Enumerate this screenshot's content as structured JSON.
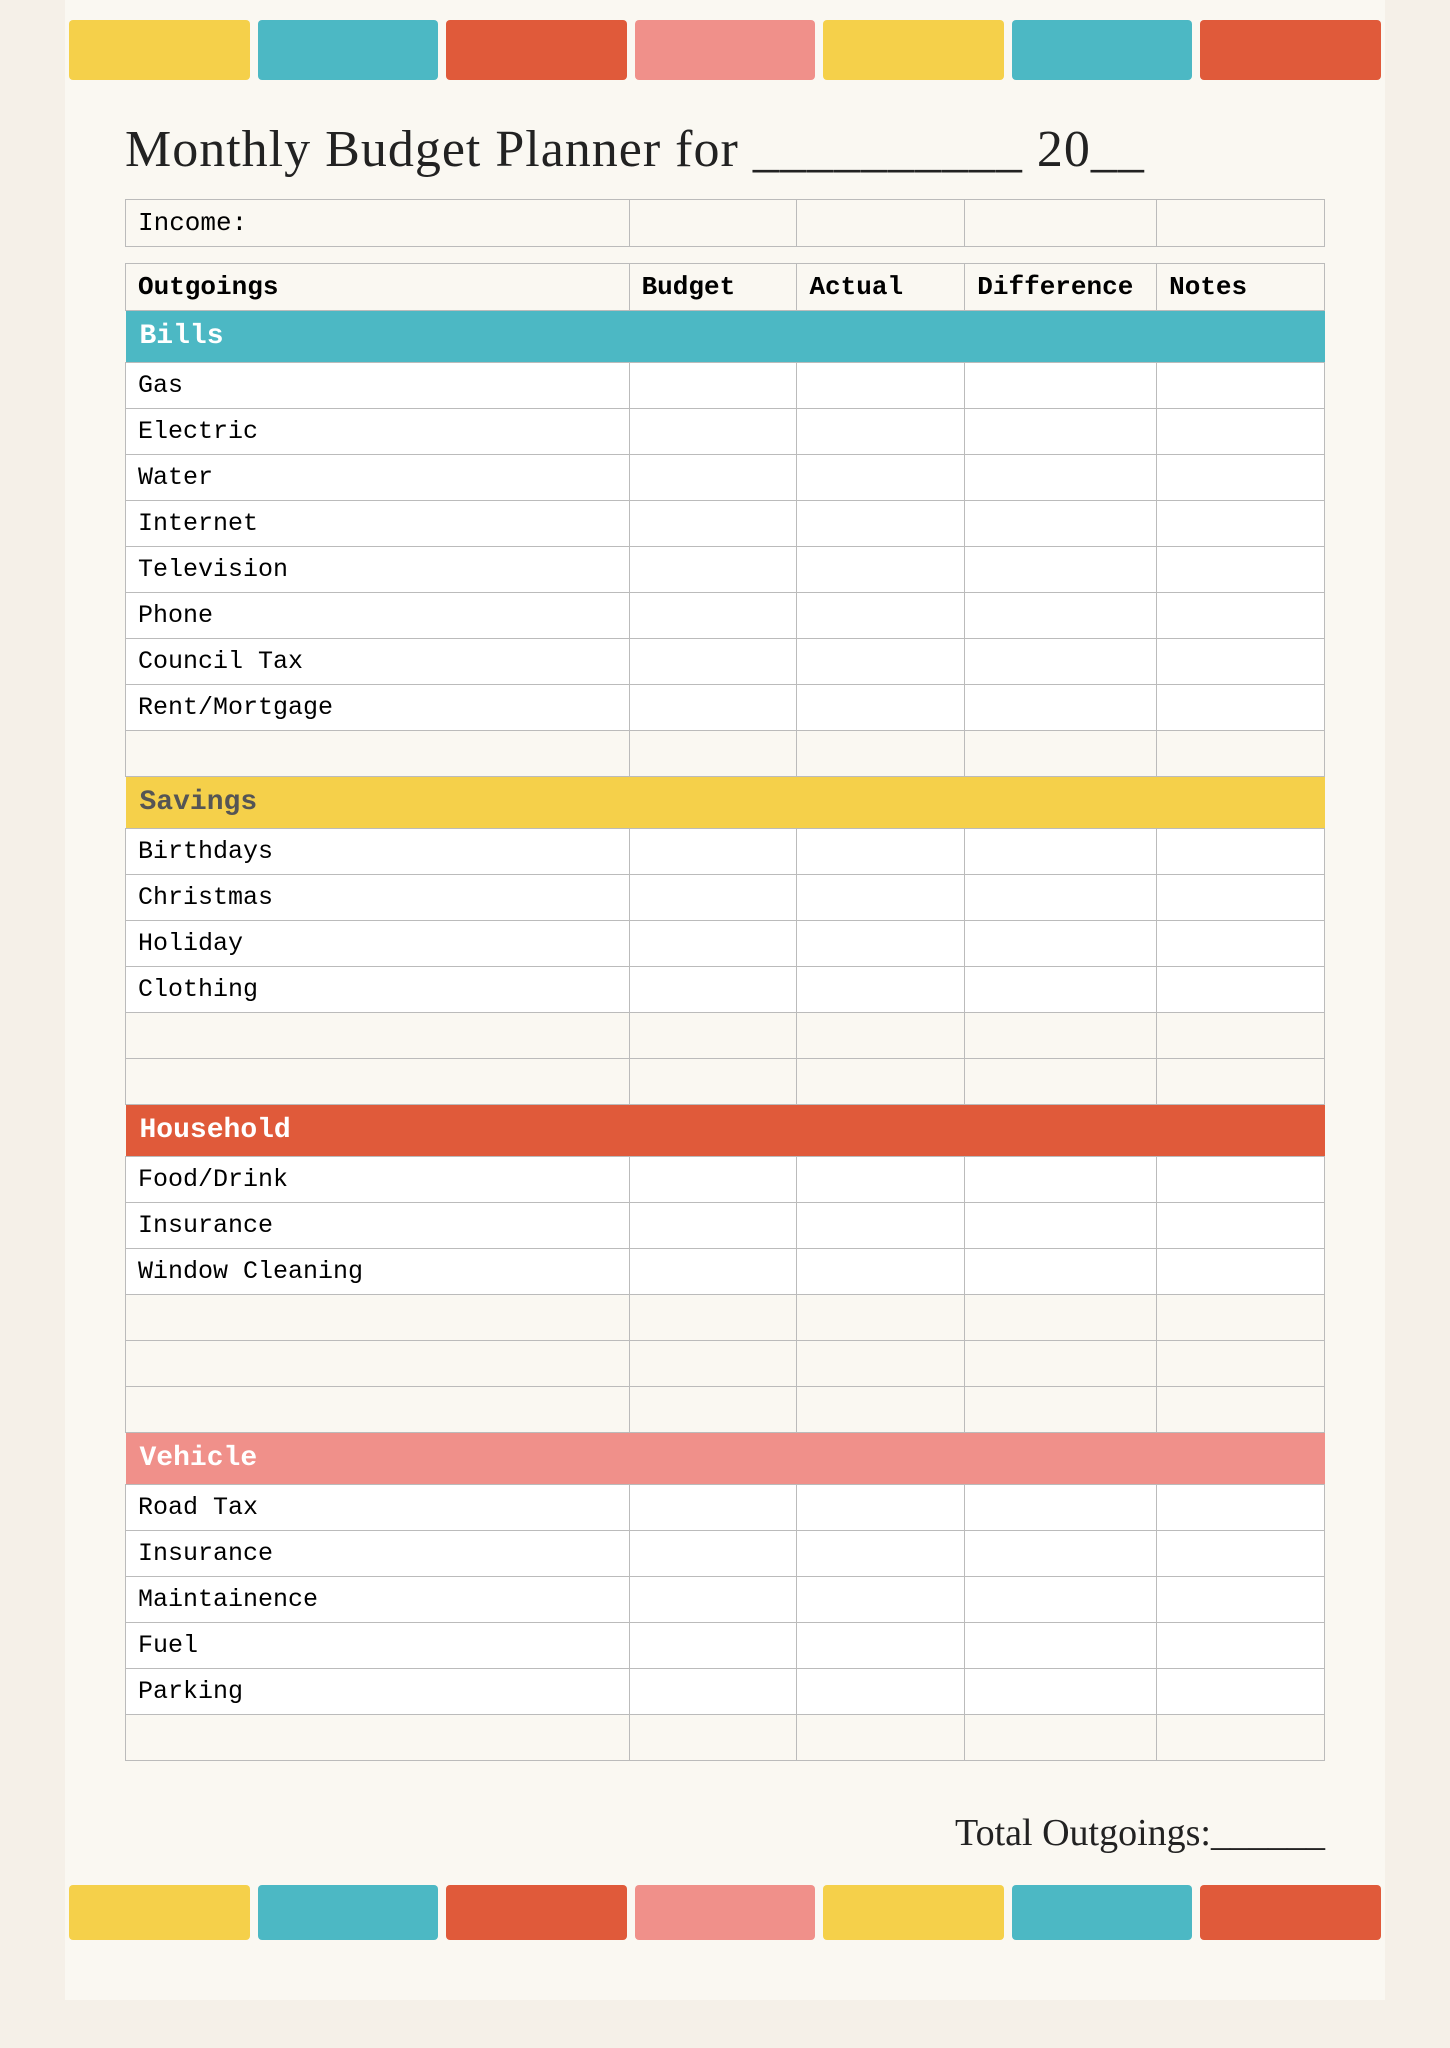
{
  "page": {
    "title": "Monthly Budget Planner for __________ 20__",
    "color_bars": [
      {
        "color": "yellow",
        "class": "cb-yellow"
      },
      {
        "color": "teal",
        "class": "cb-teal"
      },
      {
        "color": "red",
        "class": "cb-red"
      },
      {
        "color": "pink",
        "class": "cb-pink"
      },
      {
        "color": "yellow2",
        "class": "cb-yellow2"
      },
      {
        "color": "teal2",
        "class": "cb-teal2"
      },
      {
        "color": "red2",
        "class": "cb-red2"
      }
    ]
  },
  "table": {
    "income_label": "Income:",
    "columns": {
      "outgoings": "Outgoings",
      "budget": "Budget",
      "actual": "Actual",
      "difference": "Difference",
      "notes": "Notes"
    },
    "categories": [
      {
        "name": "Bills",
        "style": "cat-bills",
        "items": [
          "Gas",
          "Electric",
          "Water",
          "Internet",
          "Television",
          "Phone",
          "Council Tax",
          "Rent/Mortgage"
        ],
        "extra_empty": 1
      },
      {
        "name": "Savings",
        "style": "cat-savings",
        "items": [
          "Birthdays",
          "Christmas",
          "Holiday",
          "Clothing"
        ],
        "extra_empty": 2
      },
      {
        "name": "Household",
        "style": "cat-household",
        "items": [
          "Food/Drink",
          "Insurance",
          "Window Cleaning"
        ],
        "extra_empty": 3
      },
      {
        "name": "Vehicle",
        "style": "cat-vehicle",
        "items": [
          "Road Tax",
          "Insurance",
          "Maintainence",
          "Fuel",
          "Parking"
        ],
        "extra_empty": 1
      }
    ]
  },
  "footer": {
    "total_label": "Total Outgoings:______"
  }
}
